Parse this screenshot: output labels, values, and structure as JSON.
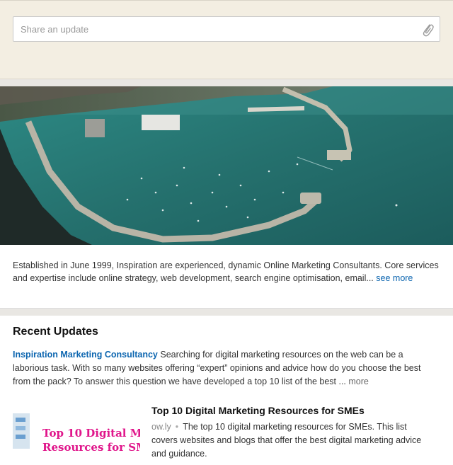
{
  "share": {
    "placeholder": "Share an update"
  },
  "about": {
    "text": "Established in June 1999, Inspiration are experienced, dynamic Online Marketing Consultants. Core services and expertise include online strategy, web development, search engine optimisation, email...",
    "see_more": "see more"
  },
  "updates": {
    "heading": "Recent Updates",
    "post": {
      "company": "Inspiration Marketing Consultancy",
      "text": "Searching for digital marketing resources on the web can be a laborious task. With so many websites offering “expert” opinions and advice how do you choose the best from the pack? To answer this question we have developed a top 10 list of the best ...",
      "more": "more"
    },
    "shared_link": {
      "thumb_line1": "Top 10 Digital M",
      "thumb_line2": "Resources for SM",
      "title": "Top 10 Digital Marketing Resources for SMEs",
      "source": "ow.ly",
      "separator": "•",
      "description": "The top 10 digital marketing resources for SMEs. This list covers websites and blogs that offer the best digital marketing advice and guidance."
    }
  },
  "colors": {
    "link": "#0d66b0",
    "share_bg": "#f3eee2",
    "sea": "#2c7d78",
    "thumb_accent": "#e0168b"
  }
}
